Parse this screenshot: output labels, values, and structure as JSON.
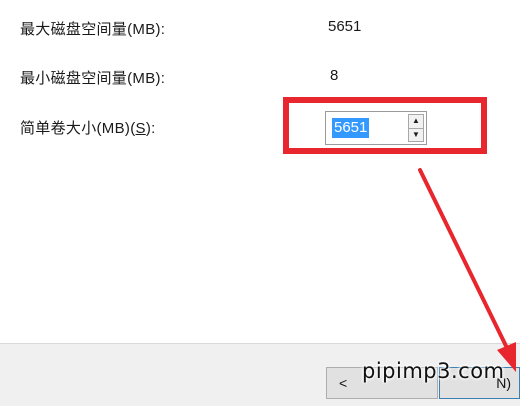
{
  "form": {
    "max_space_label": "最大磁盘空间量(MB):",
    "max_space_value": "5651",
    "min_space_label": "最小磁盘空间量(MB):",
    "min_space_value": "8",
    "volume_size_label_prefix": "简单卷大小(MB)(",
    "volume_size_label_accel": "S",
    "volume_size_label_suffix": "):",
    "volume_size_value": "5651"
  },
  "footer": {
    "back_label": "<",
    "next_label": "N)"
  },
  "watermark": "pipimp3.com",
  "colors": {
    "highlight": "#e8262d",
    "selection": "#3399ff"
  },
  "icons": {
    "spin_up": "triangle-up",
    "spin_down": "triangle-down"
  }
}
